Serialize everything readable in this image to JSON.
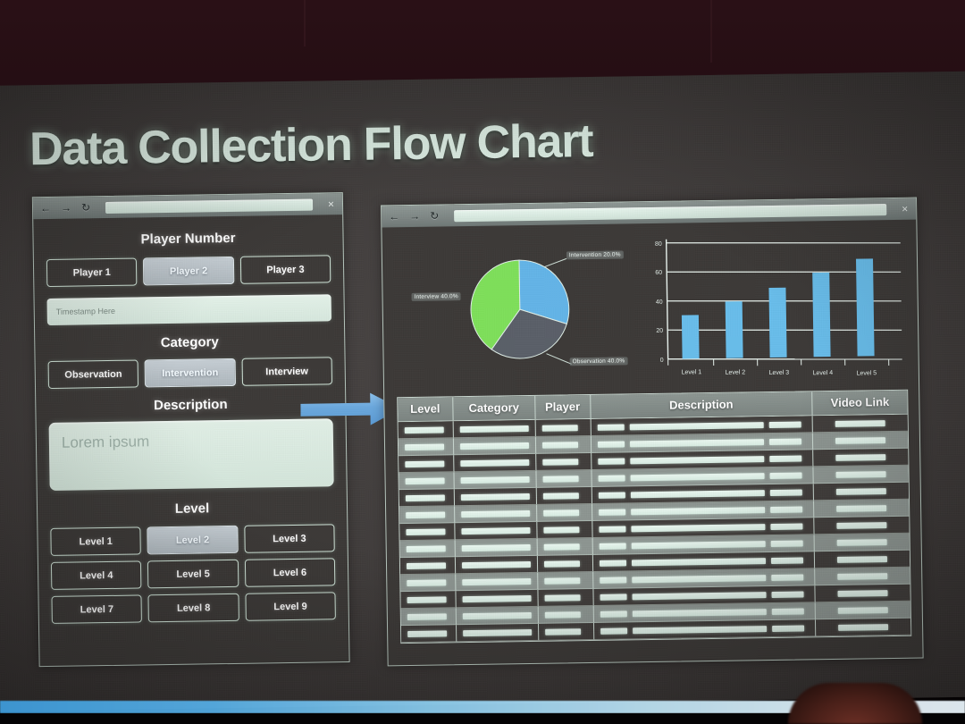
{
  "slide": {
    "title": "Data Collection Flow Chart"
  },
  "left_window": {
    "chrome": {
      "back_icon": "arrow-left",
      "forward_icon": "arrow-right",
      "reload_icon": "reload",
      "url_value": "",
      "close_label": "×"
    },
    "sections": {
      "player_number": {
        "heading": "Player Number",
        "options": [
          {
            "label": "Player 1",
            "selected": false
          },
          {
            "label": "Player 2",
            "selected": true
          },
          {
            "label": "Player 3",
            "selected": false
          }
        ]
      },
      "timestamp": {
        "placeholder": "Timestamp Here",
        "value": ""
      },
      "category": {
        "heading": "Category",
        "options": [
          {
            "label": "Observation",
            "selected": false
          },
          {
            "label": "Intervention",
            "selected": true
          },
          {
            "label": "Interview",
            "selected": false
          }
        ]
      },
      "description": {
        "heading": "Description",
        "placeholder": "Lorem ipsum",
        "value": ""
      },
      "level": {
        "heading": "Level",
        "options": [
          {
            "label": "Level 1",
            "selected": false
          },
          {
            "label": "Level 2",
            "selected": true
          },
          {
            "label": "Level 3",
            "selected": false
          },
          {
            "label": "Level 4",
            "selected": false
          },
          {
            "label": "Level 5",
            "selected": false
          },
          {
            "label": "Level 6",
            "selected": false
          },
          {
            "label": "Level 7",
            "selected": false
          },
          {
            "label": "Level 8",
            "selected": false
          },
          {
            "label": "Level 9",
            "selected": false
          }
        ]
      }
    }
  },
  "connector": {
    "icon": "arrow-right-icon",
    "color": "#6aa8de"
  },
  "right_window": {
    "chrome": {
      "back_icon": "arrow-left",
      "forward_icon": "arrow-right",
      "reload_icon": "reload",
      "url_value": "",
      "close_label": "×"
    },
    "table": {
      "columns": [
        "Level",
        "Category",
        "Player",
        "Description",
        "Video Link"
      ],
      "row_count": 13,
      "rows_are_placeholders": true
    }
  },
  "chart_data": [
    {
      "type": "pie",
      "title": "",
      "categories": [
        "Intervention",
        "Observation",
        "Interview"
      ],
      "values": [
        20,
        40,
        40
      ],
      "labels": [
        "Intervention  20.0%",
        "Observation  40.0%",
        "Interview  40.0%"
      ],
      "colors": [
        "#63b4e8",
        "#5a5f68",
        "#7ee05a"
      ],
      "legend": "labels-outside"
    },
    {
      "type": "bar",
      "title": "",
      "categories": [
        "Level 1",
        "Level 2",
        "Level 3",
        "Level 4",
        "Level 5"
      ],
      "values": [
        30,
        39,
        48,
        58,
        67
      ],
      "xlabel": "",
      "ylabel": "",
      "ylim": [
        0,
        80
      ],
      "yticks": [
        0,
        20,
        40,
        60,
        80
      ],
      "grid": true,
      "bar_color": "#68bdeb"
    }
  ]
}
